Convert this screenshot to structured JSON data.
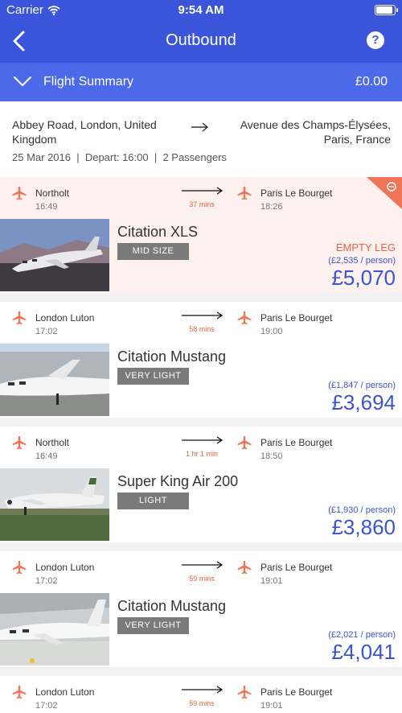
{
  "status": {
    "carrier": "Carrier",
    "time": "9:54 AM"
  },
  "nav": {
    "title": "Outbound",
    "help": "?"
  },
  "summary": {
    "label": "Flight Summary",
    "total": "£0.00"
  },
  "route": {
    "from": "Abbey Road, London, United Kingdom",
    "to": "Avenue des Champs-Élysées, Paris, France",
    "date": "25 Mar 2016",
    "depart": "Depart: 16:00",
    "passengers": "2 Passengers"
  },
  "flights": [
    {
      "dep": "Northolt",
      "dep_time": "16:49",
      "duration": "37 mins",
      "arr": "Paris Le Bourget",
      "arr_time": "18:26",
      "aircraft": "Citation XLS",
      "category": "MID SIZE",
      "empty_leg": "EMPTY LEG",
      "per_person": "(£2,535 / person)",
      "price": "£5,070"
    },
    {
      "dep": "London Luton",
      "dep_time": "17:02",
      "duration": "58 mins",
      "arr": "Paris Le Bourget",
      "arr_time": "19:00",
      "aircraft": "Citation Mustang",
      "category": "VERY LIGHT",
      "per_person": "(£1,847 / person)",
      "price": "£3,694"
    },
    {
      "dep": "Northolt",
      "dep_time": "16:49",
      "duration": "1 hr 1 min",
      "arr": "Paris Le Bourget",
      "arr_time": "18:50",
      "aircraft": "Super King Air 200",
      "category": "LIGHT",
      "per_person": "(£1,930 / person)",
      "price": "£3,860"
    },
    {
      "dep": "London Luton",
      "dep_time": "17:02",
      "duration": "59 mins",
      "arr": "Paris Le Bourget",
      "arr_time": "19:01",
      "aircraft": "Citation Mustang",
      "category": "VERY LIGHT",
      "per_person": "(£2,021 / person)",
      "price": "£4,041"
    },
    {
      "dep": "London Luton",
      "dep_time": "17:02",
      "duration": "59 mins",
      "arr": "Paris Le Bourget",
      "arr_time": "19:01"
    }
  ],
  "colors": {
    "brand": "#3a55d9",
    "summary": "#4c69ea",
    "accent": "#e8623f",
    "price": "#3b55d0",
    "highlight": "#fdf1ef"
  }
}
